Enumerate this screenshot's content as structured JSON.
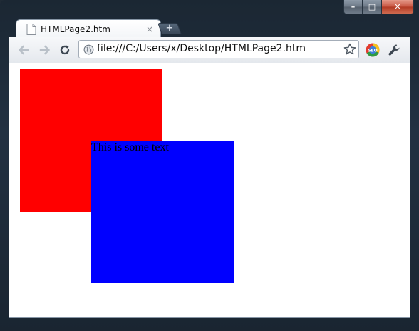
{
  "window": {
    "caption_buttons": {
      "minimize": "–",
      "maximize": "□",
      "close": "✕"
    }
  },
  "tab": {
    "title": "HTMLPage2.htm",
    "close": "×"
  },
  "new_tab": {
    "label": "+"
  },
  "toolbar": {
    "url": "file:///C:/Users/x/Desktop/HTMLPage2.htm",
    "seo_icon_label": "SEO"
  },
  "page": {
    "text": "This is some text",
    "colors": {
      "red_box": "#ff0000",
      "blue_box": "#0000ff"
    }
  }
}
